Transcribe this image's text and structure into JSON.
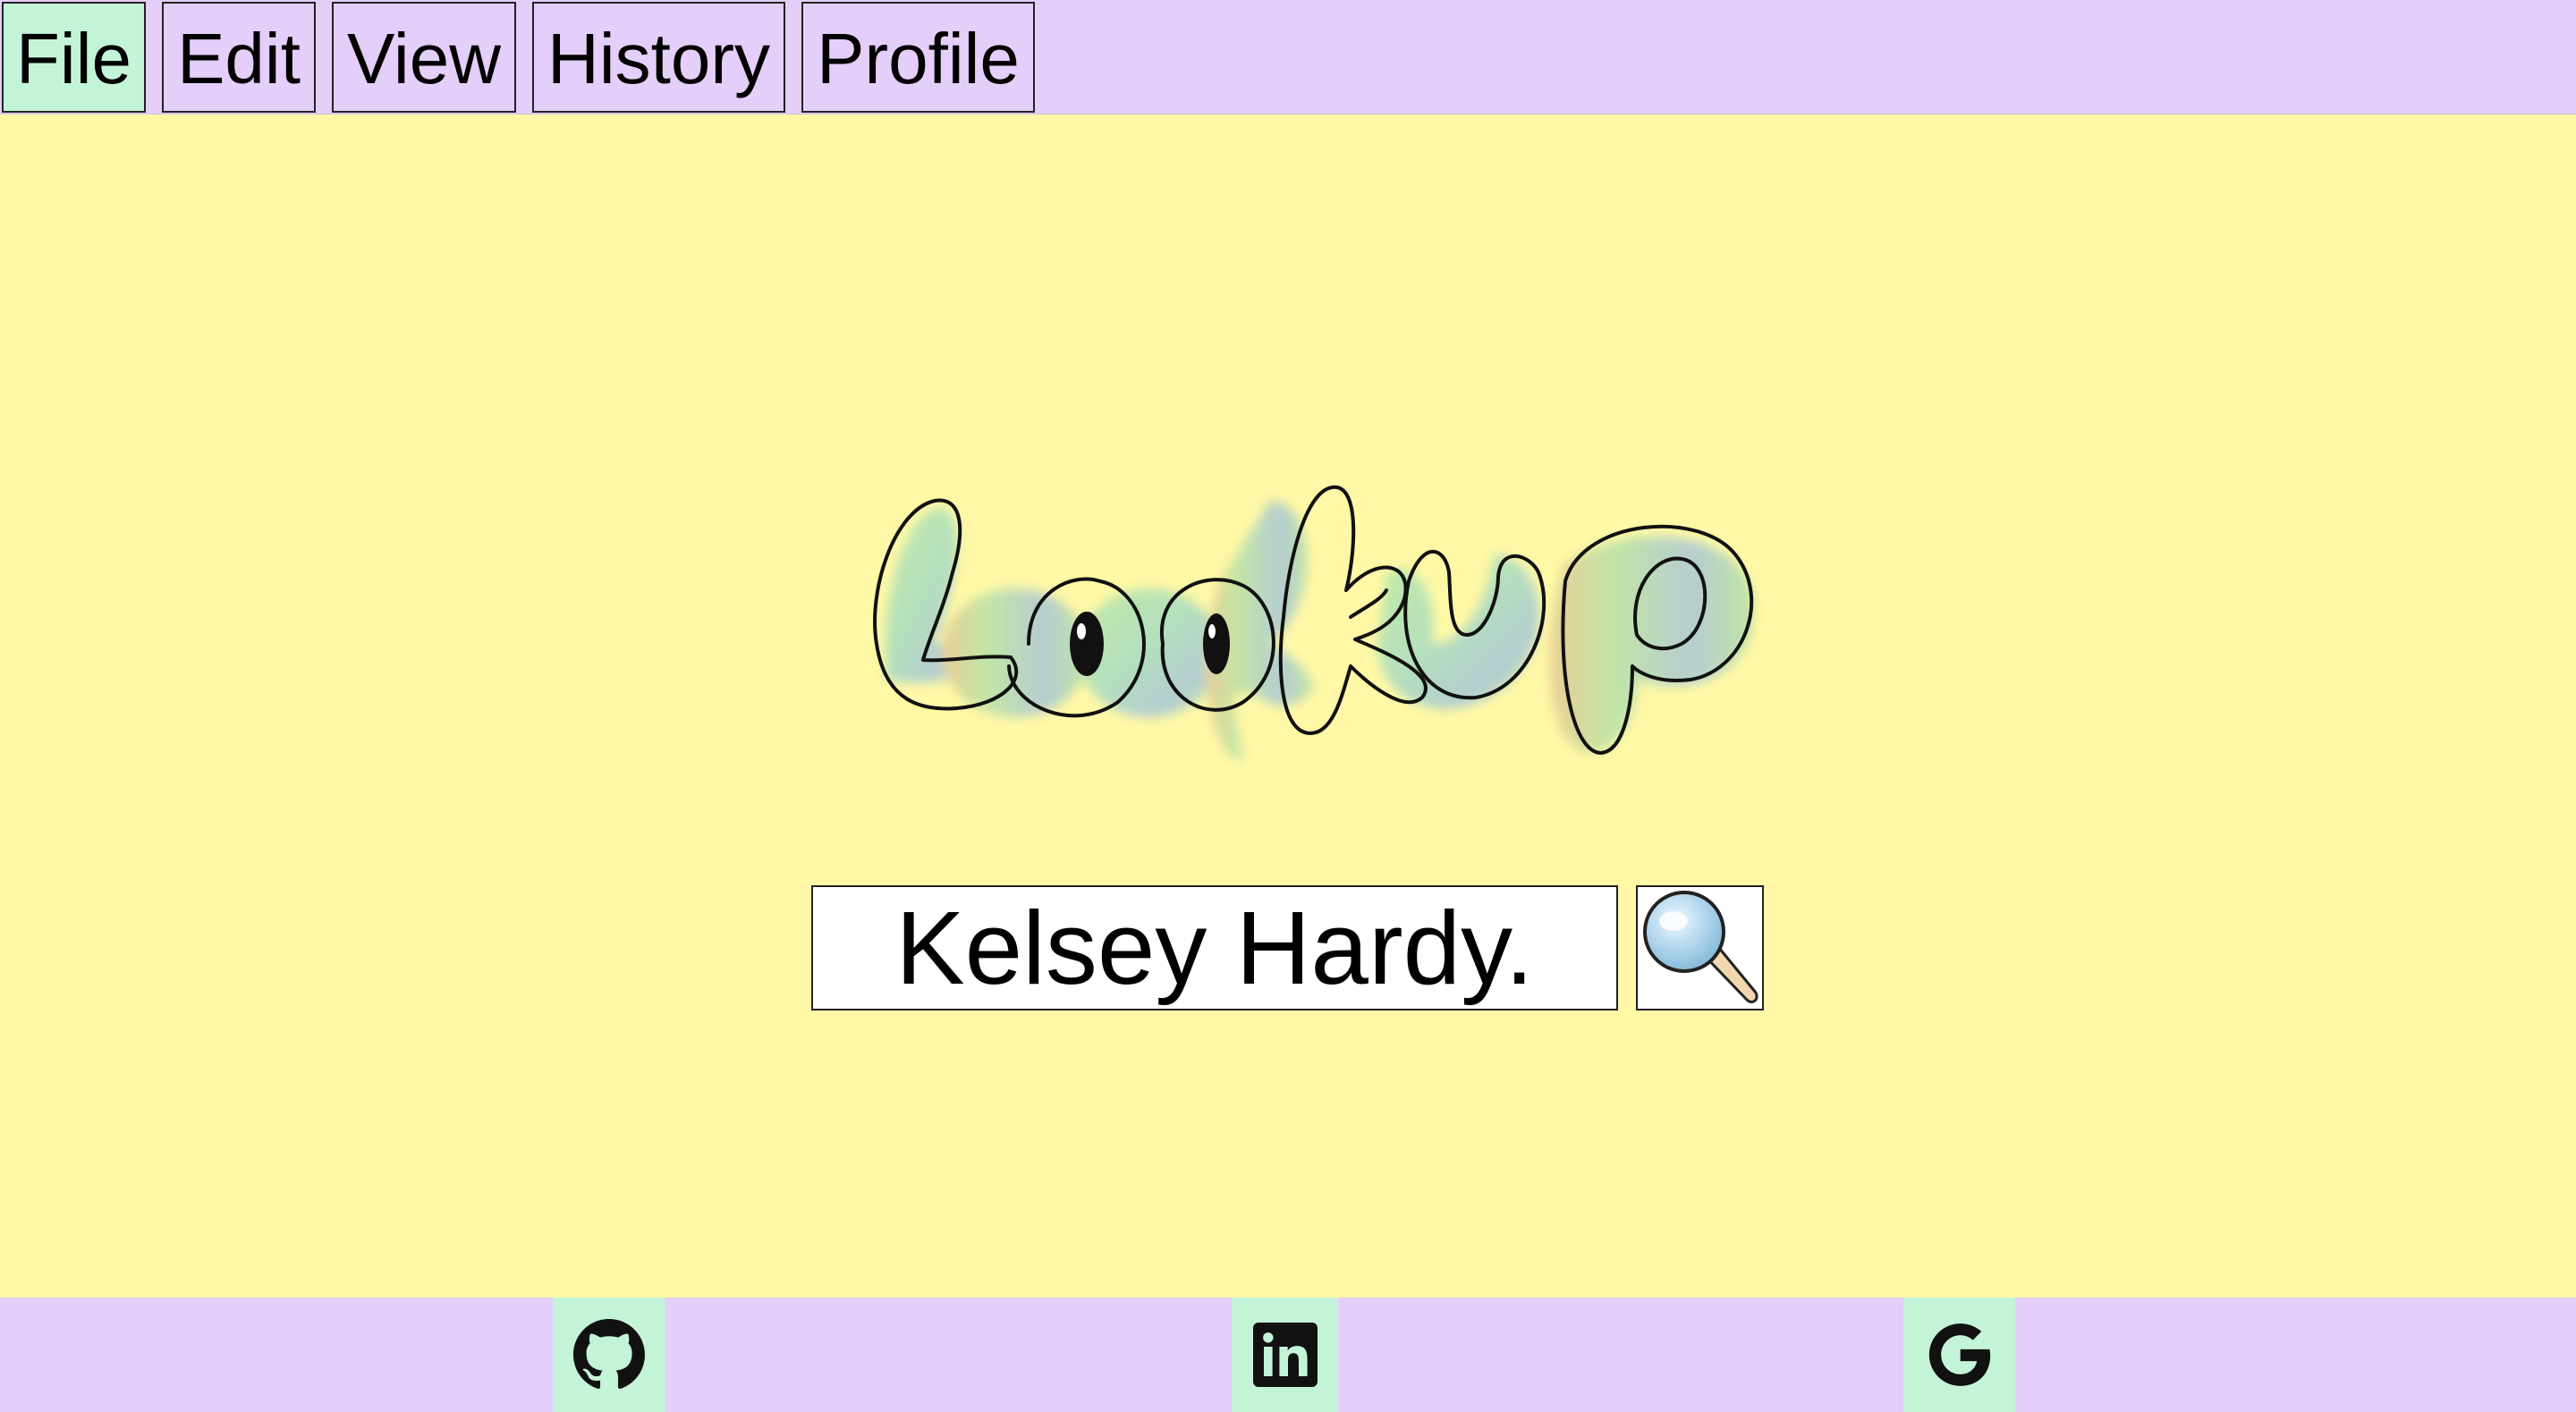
{
  "menu": {
    "items": [
      {
        "label": "File",
        "active": true
      },
      {
        "label": "Edit",
        "active": false
      },
      {
        "label": "View",
        "active": false
      },
      {
        "label": "History",
        "active": false
      },
      {
        "label": "Profile",
        "active": false
      }
    ]
  },
  "logo": {
    "text": "Lookup"
  },
  "search": {
    "value": "Kelsey Hardy.",
    "button_icon": "magnifying-glass-icon"
  },
  "footer": {
    "links": [
      {
        "icon": "github-icon"
      },
      {
        "icon": "linkedin-icon"
      },
      {
        "icon": "google-icon"
      }
    ]
  },
  "colors": {
    "page_background": "#fff8a6",
    "bar_background": "#e3cff9",
    "active_highlight": "#c4f4d8"
  }
}
